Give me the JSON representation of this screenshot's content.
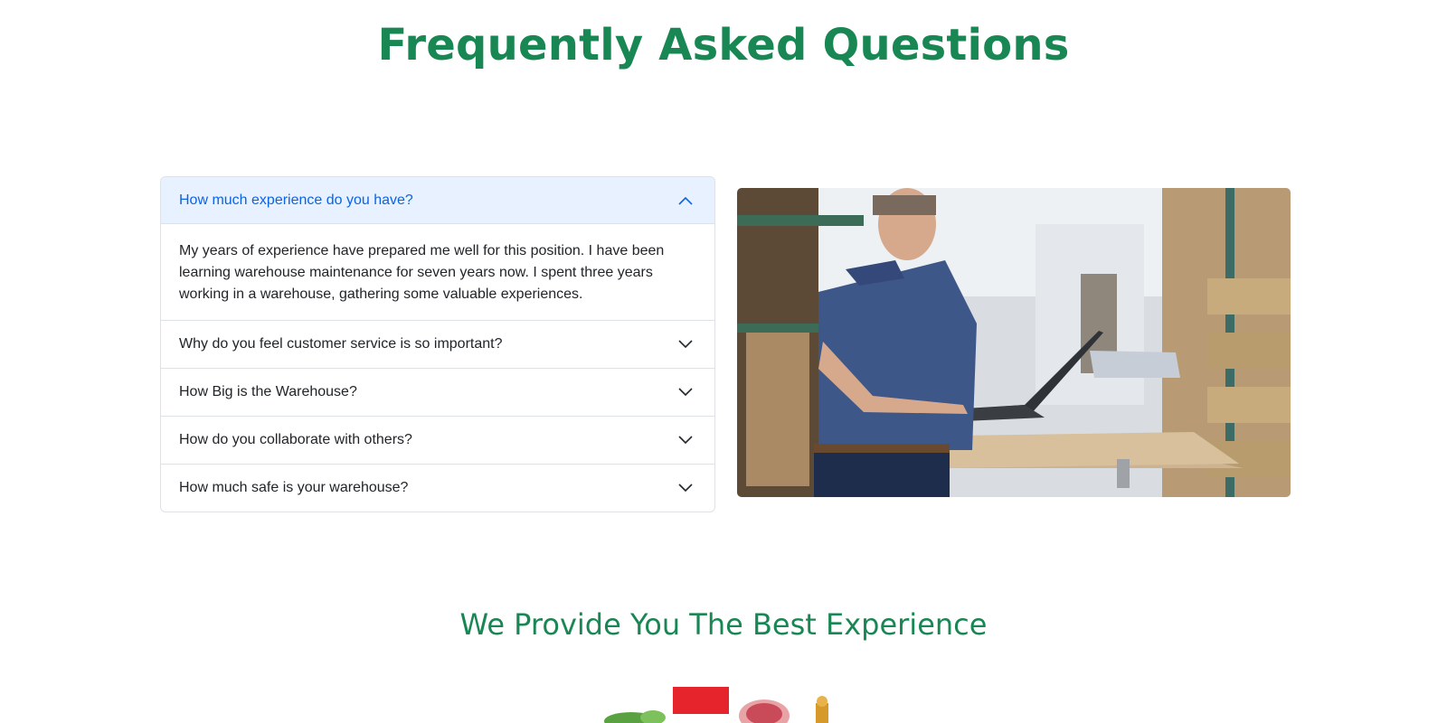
{
  "page_title": "Frequently Asked Questions",
  "faq": {
    "items": [
      {
        "question": "How much experience do you have?",
        "answer": "My years of experience have prepared me well for this position. I have been learning warehouse maintenance for seven years now. I spent three years working in a warehouse, gathering some valuable experiences.",
        "expanded": true
      },
      {
        "question": "Why do you feel customer service is so important?",
        "expanded": false
      },
      {
        "question": "How Big is the Warehouse?",
        "expanded": false
      },
      {
        "question": "How do you collaborate with others?",
        "expanded": false
      },
      {
        "question": "How much safe is your warehouse?",
        "expanded": false
      }
    ]
  },
  "section_title": "We Provide You The Best Experience",
  "colors": {
    "accent": "#198754",
    "active_header_bg": "#e7f1ff",
    "active_header_text": "#0c63e4"
  }
}
